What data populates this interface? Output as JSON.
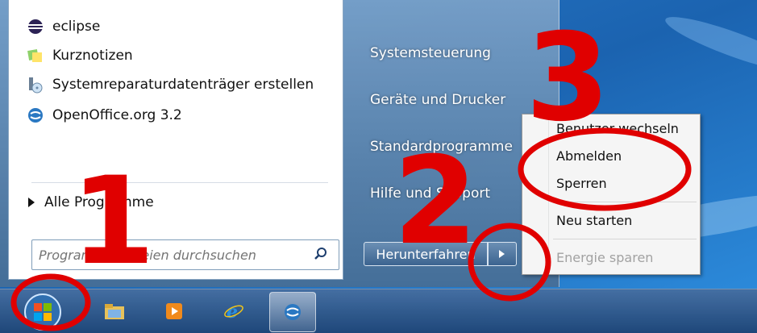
{
  "start_menu": {
    "programs": [
      {
        "label": "eclipse",
        "icon": "eclipse-icon"
      },
      {
        "label": "Kurznotizen",
        "icon": "sticky-notes-icon"
      },
      {
        "label": "Systemreparaturdatenträger erstellen",
        "icon": "repair-disc-icon"
      },
      {
        "label": "OpenOffice.org 3.2",
        "icon": "openoffice-icon"
      }
    ],
    "all_programs_label": "Alle Programme",
    "search_placeholder": "Programme/Dateien durchsuchen"
  },
  "right_column": {
    "items": [
      {
        "label": "Systemsteuerung"
      },
      {
        "label": "Geräte und Drucker"
      },
      {
        "label": "Standardprogramme"
      },
      {
        "label": "Hilfe und Support"
      }
    ],
    "shutdown_label": "Herunterfahren"
  },
  "shutdown_submenu": {
    "items": [
      {
        "label": "Benutzer wechseln",
        "enabled": true
      },
      {
        "label": "Abmelden",
        "enabled": true
      },
      {
        "label": "Sperren",
        "enabled": true
      },
      {
        "label": "Neu starten",
        "enabled": true
      },
      {
        "label": "Energie sparen",
        "enabled": false
      }
    ]
  },
  "taskbar": {
    "buttons": [
      {
        "name": "start-orb-icon"
      },
      {
        "name": "explorer-icon"
      },
      {
        "name": "media-player-icon"
      },
      {
        "name": "internet-explorer-icon"
      },
      {
        "name": "openoffice-icon",
        "active": true
      }
    ]
  },
  "annotations": [
    "1",
    "2",
    "3"
  ],
  "colors": {
    "annotation": "#e00000",
    "menu_text": "#111111",
    "disabled_text": "#a2a2a2"
  }
}
